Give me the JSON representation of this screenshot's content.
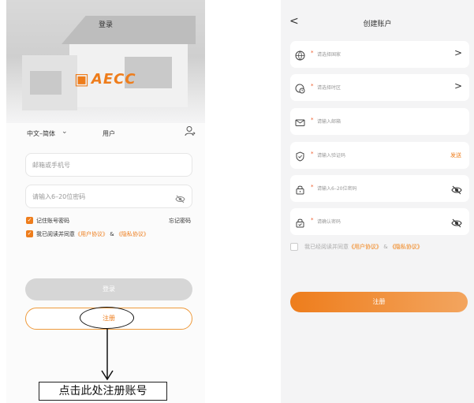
{
  "login": {
    "title": "登录",
    "logo_text": "AECC",
    "language": "中文–简体",
    "user_tab": "用户",
    "email_placeholder": "邮箱或手机号",
    "password_placeholder": "请输入6–20位密码",
    "remember_label": "记住账号密码",
    "forgot_label": "忘记密码",
    "agree_prefix": "我已阅读并同意",
    "user_agreement": "《用户协议》",
    "amp": "&",
    "privacy_agreement": "《隐私协议》",
    "login_button": "登录",
    "register_button": "注册",
    "callout": "点击此处注册账号"
  },
  "create": {
    "title": "创建账户",
    "back": "<",
    "rows": [
      {
        "icon": "globe-icon",
        "placeholder": "请选择国家",
        "action": ">"
      },
      {
        "icon": "timezone-icon",
        "placeholder": "请选择时区",
        "action": ">"
      },
      {
        "icon": "mail-icon",
        "placeholder": "请输入邮箱"
      },
      {
        "icon": "shield-icon",
        "placeholder": "请输入验证码",
        "action": "发送"
      },
      {
        "icon": "lock-icon",
        "placeholder": "请输入6–20位密码"
      },
      {
        "icon": "lock-check-icon",
        "placeholder": "请确认密码"
      }
    ],
    "agree_prefix": "我已经阅读并同意",
    "user_agreement": "《用户协议》",
    "amp": "&",
    "privacy_agreement": "《隐私协议》",
    "register_button": "注册"
  },
  "colors": {
    "accent": "#ee7d1c",
    "required": "#ee5a2a"
  }
}
